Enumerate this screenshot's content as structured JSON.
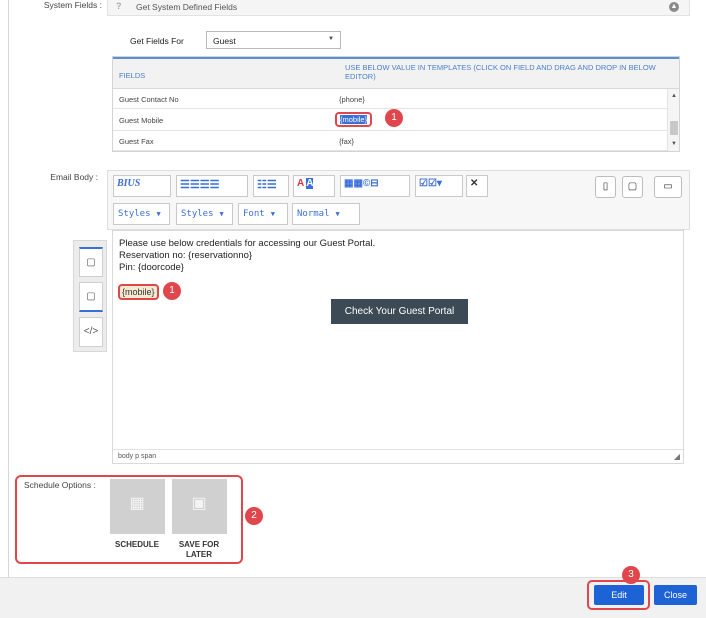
{
  "system_fields": {
    "label": "System Fields :",
    "header_title": "Get System Defined Fields",
    "get_fields_label": "Get Fields For",
    "get_fields_value": "Guest",
    "table_headers": [
      "FIELDS",
      "USE BELOW VALUE IN TEMPLATES (CLICK ON FIELD AND DRAG AND DROP IN BELOW EDITOR)"
    ],
    "rows": [
      {
        "field": "Guest Contact No",
        "value": "{phone}"
      },
      {
        "field": "Guest Mobile",
        "value": "{mobile}"
      },
      {
        "field": "Guest Fax",
        "value": "{fax}"
      }
    ]
  },
  "email_body": {
    "label": "Email Body :",
    "toolbar": {
      "format_group": "BIUS",
      "styles1": "Styles",
      "styles2": "Styles",
      "font": "Font",
      "size": "Normal"
    },
    "content_lines": [
      "Please use below credentials for accessing our Guest Portal.",
      "Reservation no: {reservationno}",
      "Pin: {doorcode}"
    ],
    "inserted_tag": "{mobile}",
    "portal_button": "Check Your Guest Portal",
    "status_path": "body  p  span",
    "source_icon": "</>"
  },
  "schedule": {
    "label": "Schedule Options :",
    "options": [
      "SCHEDULE",
      "SAVE FOR LATER"
    ]
  },
  "badges": [
    "1",
    "1",
    "2",
    "3"
  ],
  "footer": {
    "edit": "Edit",
    "close": "Close"
  },
  "colors": {
    "accent_blue": "#1e63d6",
    "highlight_red": "#e0474c",
    "portal_button_bg": "#3c4a55"
  }
}
